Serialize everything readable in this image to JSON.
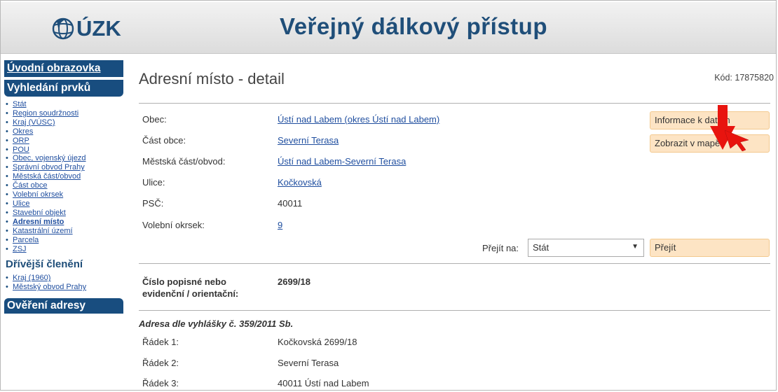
{
  "header": {
    "logo_text": "ÚZK",
    "title": "Veřejný dálkový přístup"
  },
  "sidebar": {
    "home_label": "Úvodní obrazovka",
    "search_heading": "Vyhledání prvků",
    "search_items": [
      "Stát",
      "Region soudržnosti",
      "Kraj (VÚSC)",
      "Okres",
      "ORP",
      "POU",
      "Obec, vojenský újezd",
      "Správní obvod Prahy",
      "Městská část/obvod",
      "Část obce",
      "Volební okrsek",
      "Ulice",
      "Stavební objekt",
      "Adresní místo",
      "Katastrální území",
      "Parcela",
      "ZSJ"
    ],
    "former_heading": "Dřívější členění",
    "former_items": [
      "Kraj (1960)",
      "Městský obvod Prahy"
    ],
    "verify_heading": "Ověření adresy"
  },
  "main": {
    "title": "Adresní místo - detail",
    "code": "Kód: 17875820",
    "fields": [
      {
        "label": "Obec:",
        "value": "Ústí nad Labem (okres Ústí nad Labem)",
        "link": true
      },
      {
        "label": "Část obce:",
        "value": "Severní Terasa",
        "link": true
      },
      {
        "label": "Městská část/obvod:",
        "value": "Ústí nad Labem-Severní Terasa",
        "link": true
      },
      {
        "label": "Ulice:",
        "value": "Kočkovská",
        "link": true
      },
      {
        "label": "PSČ:",
        "value": "40011",
        "link": false
      },
      {
        "label": "Volební okrsek:",
        "value": "9",
        "link": true
      }
    ],
    "buttons": {
      "info": "Informace k datům",
      "map": "Zobrazit v mapě",
      "go": "Přejít"
    },
    "goto_label": "Přejít na:",
    "goto_select": "Stát",
    "number_label_1": "Číslo popisné nebo",
    "number_label_2": "evidenční / orientační:",
    "number_value": "2699/18",
    "address_heading": "Adresa dle vyhlášky č. 359/2011 Sb.",
    "address_lines": [
      {
        "label": "Řádek 1:",
        "value": "Kočkovská 2699/18"
      },
      {
        "label": "Řádek 2:",
        "value": "Severní Terasa"
      },
      {
        "label": "Řádek 3:",
        "value": "40011 Ústí nad Labem"
      }
    ]
  },
  "colors": {
    "brand": "#1f4e79",
    "sidebar_box": "#184d7f",
    "button_bg": "#fde4c4",
    "arrow": "#e8140f"
  }
}
